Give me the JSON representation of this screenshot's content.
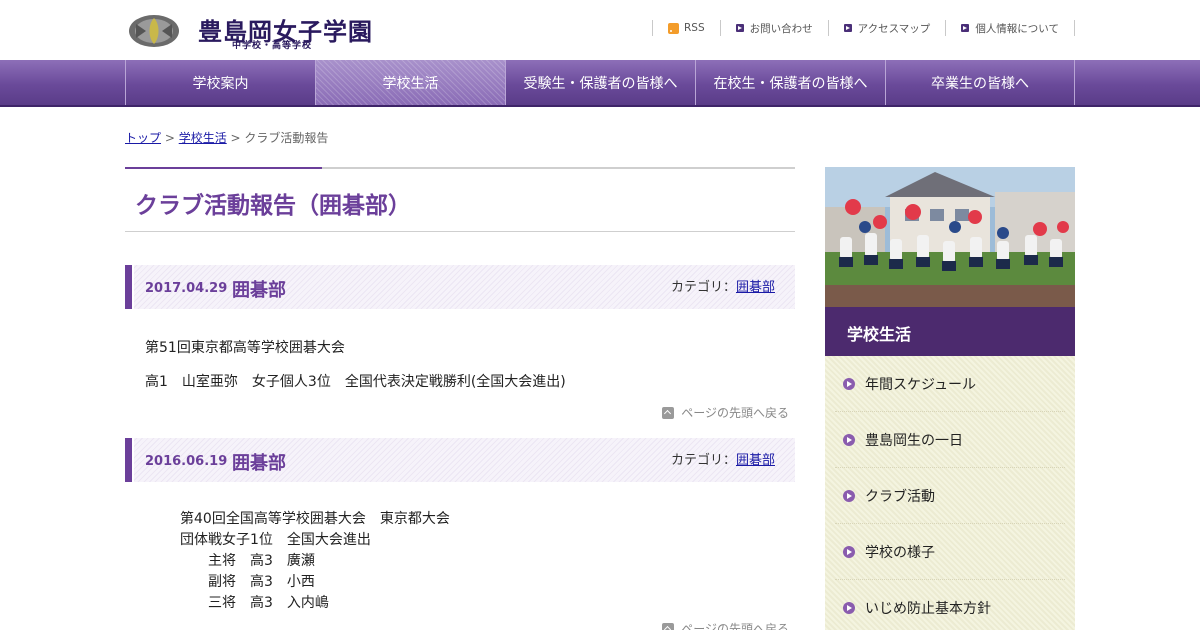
{
  "header": {
    "logo_title": "豊島岡女子学園",
    "logo_sub": "中学校・高等学校",
    "util": [
      {
        "label": "RSS",
        "icon": "rss-icon"
      },
      {
        "label": "お問い合わせ",
        "icon": "arrow-icon"
      },
      {
        "label": "アクセスマップ",
        "icon": "arrow-icon"
      },
      {
        "label": "個人情報について",
        "icon": "arrow-icon"
      }
    ]
  },
  "gnav": [
    {
      "label": "学校案内"
    },
    {
      "label": "学校生活",
      "active": true
    },
    {
      "label": "受験生・保護者の皆様へ"
    },
    {
      "label": "在校生・保護者の皆様へ"
    },
    {
      "label": "卒業生の皆様へ"
    }
  ],
  "breadcrumb": {
    "top": "トップ",
    "sep1": " > ",
    "parent": "学校生活",
    "sep2": " > ",
    "current": "クラブ活動報告"
  },
  "page_title": "クラブ活動報告（囲碁部）",
  "posts": [
    {
      "date": "2017.04.29",
      "title": "囲碁部",
      "category_label": "カテゴリ：",
      "category": "囲碁部",
      "lines": [
        "第51回東京都高等学校囲碁大会",
        "高1　山室亜弥　女子個人3位　全国代表決定戦勝利(全国大会進出)"
      ],
      "to_top": "ページの先頭へ戻る"
    },
    {
      "date": "2016.06.19",
      "title": "囲碁部",
      "category_label": "カテゴリ：",
      "category": "囲碁部",
      "lines": [
        "第40回全国高等学校囲碁大会　東京都大会",
        "団体戦女子1位　全国大会進出",
        "主将　高3　廣瀬",
        "副将　高3　小西",
        "三将　高3　入内嶋"
      ],
      "to_top": "ページの先頭へ戻る"
    }
  ],
  "sidebar": {
    "title": "学校生活",
    "items": [
      {
        "label": "年間スケジュール"
      },
      {
        "label": "豊島岡生の一日"
      },
      {
        "label": "クラブ活動"
      },
      {
        "label": "学校の様子"
      },
      {
        "label": "いじめ防止基本方針"
      }
    ]
  },
  "colors": {
    "accent": "#6b3f9a",
    "nav": "#6a4a9a",
    "sidebar_title": "#4c2a6e"
  }
}
